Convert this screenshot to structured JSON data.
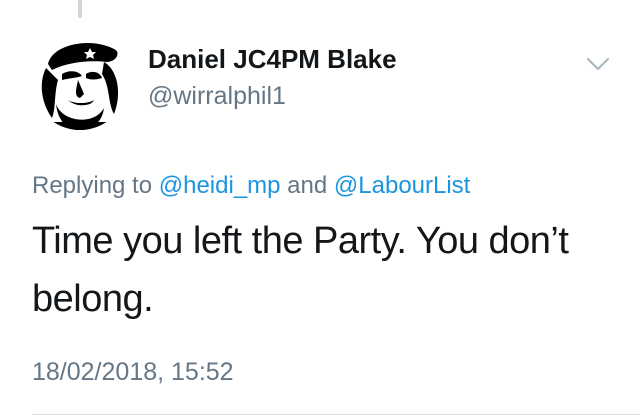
{
  "tweet": {
    "author": {
      "display_name": "Daniel JC4PM Blake",
      "handle": "@wirralphil1",
      "avatar_icon": "che-guevara-portrait-icon"
    },
    "reply": {
      "prefix": "Replying to ",
      "mention_1": "@heidi_mp",
      "conjunction": " and ",
      "mention_2": "@LabourList"
    },
    "text": "Time you left the Party. You don’t belong.",
    "timestamp": "18/02/2018, 15:52"
  },
  "colors": {
    "text_primary": "#14171a",
    "text_secondary": "#657786",
    "link": "#1b95e0",
    "divider": "#d8dde1"
  }
}
